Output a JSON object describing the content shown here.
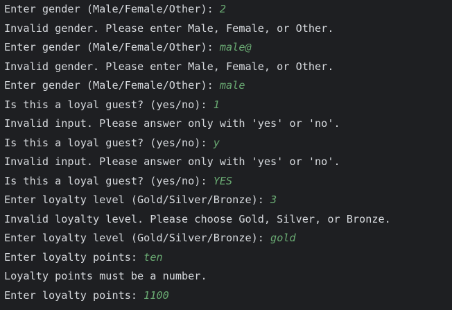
{
  "console": {
    "lines": [
      {
        "prompt": "Enter gender (Male/Female/Other): ",
        "input": "2"
      },
      {
        "prompt": "Invalid gender. Please enter Male, Female, or Other.",
        "input": ""
      },
      {
        "prompt": "Enter gender (Male/Female/Other): ",
        "input": "male@"
      },
      {
        "prompt": "Invalid gender. Please enter Male, Female, or Other.",
        "input": ""
      },
      {
        "prompt": "Enter gender (Male/Female/Other): ",
        "input": "male"
      },
      {
        "prompt": "Is this a loyal guest? (yes/no): ",
        "input": "1"
      },
      {
        "prompt": "Invalid input. Please answer only with 'yes' or 'no'.",
        "input": ""
      },
      {
        "prompt": "Is this a loyal guest? (yes/no): ",
        "input": "y"
      },
      {
        "prompt": "Invalid input. Please answer only with 'yes' or 'no'.",
        "input": ""
      },
      {
        "prompt": "Is this a loyal guest? (yes/no): ",
        "input": "YES"
      },
      {
        "prompt": "Enter loyalty level (Gold/Silver/Bronze): ",
        "input": "3"
      },
      {
        "prompt": "Invalid loyalty level. Please choose Gold, Silver, or Bronze.",
        "input": ""
      },
      {
        "prompt": "Enter loyalty level (Gold/Silver/Bronze): ",
        "input": "gold"
      },
      {
        "prompt": "Enter loyalty points: ",
        "input": "ten"
      },
      {
        "prompt": "Loyalty points must be a number.",
        "input": ""
      },
      {
        "prompt": "Enter loyalty points: ",
        "input": "1100"
      }
    ]
  },
  "colors": {
    "background": "#1e1f22",
    "output_text": "#d7dade",
    "user_input": "#6aab73"
  }
}
